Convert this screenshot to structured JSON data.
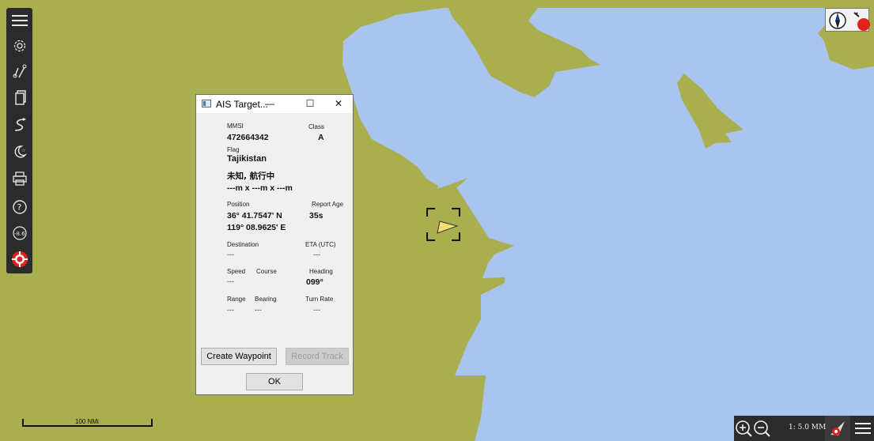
{
  "dialog": {
    "title": "AIS Target...",
    "minimize_glyph": "—",
    "maximize_glyph": "☐",
    "close_glyph": "✕",
    "mmsi_label": "MMSI",
    "mmsi_value": "472664342",
    "class_label": "Class",
    "class_value": "A",
    "flag_label": "Flag",
    "flag_value": "Tajikistan",
    "status_value": "未知, 航行中",
    "dimensions_value": "---m x ---m x ---m",
    "position_label": "Position",
    "report_age_label": "Report Age",
    "latitude": "36° 41.7547' N",
    "report_age_value": "35s",
    "longitude": "119° 08.9625' E",
    "destination_label": "Destination",
    "eta_label": "ETA (UTC)",
    "destination_value": "---",
    "eta_value": "---",
    "speed_label": "Speed",
    "course_label": "Course",
    "heading_label": "Heading",
    "speed_value": "---",
    "heading_value": "099°",
    "range_label": "Range",
    "bearing_label": "Bearing",
    "turn_rate_label": "Turn Rate",
    "range_value": "---",
    "bearing_value": "---",
    "turn_rate_value": "---",
    "create_waypoint_label": "Create Waypoint",
    "record_track_label": "Record Track",
    "ok_label": "OK"
  },
  "toolbar": {
    "items": [
      "menu-icon",
      "settings-icon",
      "route-icon",
      "copy-icon",
      "track-icon",
      "night-mode-icon",
      "print-icon",
      "help-icon",
      "mob-icon",
      "lifebuoy-icon"
    ]
  },
  "map": {
    "scale_label": "100 NMi",
    "zoom_scale": "1: 5.0 MM",
    "colors": {
      "land": "#a9af4f",
      "water": "#a9c4ee",
      "target": "#f3df6d",
      "toolbar": "#2b2b2b",
      "danger": "#e1221c"
    }
  }
}
